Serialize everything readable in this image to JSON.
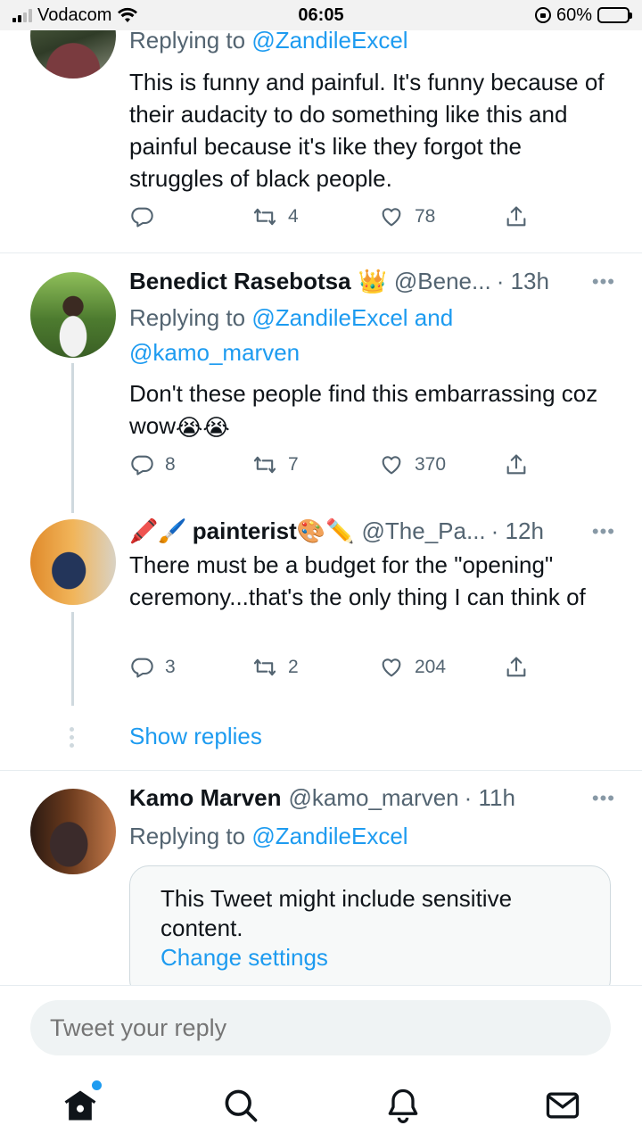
{
  "status_bar": {
    "carrier": "Vodacom",
    "time": "06:05",
    "battery_percent": "60%",
    "battery_level": 0.6,
    "icons": [
      "signal-icon",
      "wifi-icon",
      "rotation-lock-icon",
      "battery-icon"
    ]
  },
  "tweets": [
    {
      "reply_label": "Replying to ",
      "reply_to": "@ZandileExcel",
      "text": "This is funny and painful. It's funny because of their audacity to do something like this and painful because it's like they forgot the struggles of black people.",
      "replies": "",
      "retweets": "4",
      "likes": "78"
    },
    {
      "name": "Benedict Rasebotsa",
      "badge_emoji": "👑",
      "handle": "@Bene...",
      "time": "· 13h",
      "reply_label": "Replying to ",
      "reply_to": "@ZandileExcel",
      "reply_and": " and",
      "reply_to_2": "@kamo_marven",
      "text": "Don't these people find this embarrassing coz wow",
      "text_emoji": "😭😭",
      "replies": "8",
      "retweets": "7",
      "likes": "370"
    },
    {
      "name_prefix_emoji": "🖍️🖌️",
      "name": "painterist",
      "name_suffix_emoji": "🎨✏️",
      "handle": "@The_Pa...",
      "time": "· 12h",
      "text": "There must be a budget for the \"opening\" ceremony...that's the only thing I can think of",
      "replies": "3",
      "retweets": "2",
      "likes": "204"
    },
    {
      "name": "Kamo Marven",
      "handle": "@kamo_marven",
      "time": "· 11h",
      "reply_label": "Replying to ",
      "reply_to": "@ZandileExcel",
      "sensitive_notice": "This Tweet might include sensitive content.",
      "change_settings": "Change settings"
    }
  ],
  "more_glyph": "•••",
  "show_replies": "Show replies",
  "composer": {
    "placeholder": "Tweet your reply"
  },
  "tabs": [
    "home-icon",
    "search-icon",
    "notifications-icon",
    "messages-icon"
  ],
  "colors": {
    "accent": "#1d9bf0",
    "text": "#0f1419",
    "secondary": "#536471"
  }
}
